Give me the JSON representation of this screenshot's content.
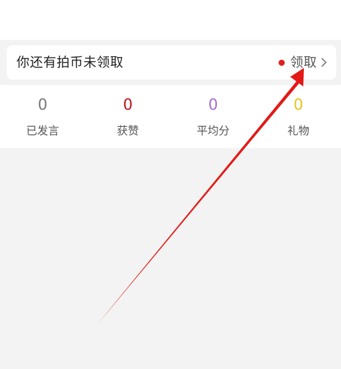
{
  "banner": {
    "message": "你还有拍币未领取",
    "claim_label": "领取"
  },
  "stats": [
    {
      "value": "0",
      "label": "已发言",
      "color": "#777777"
    },
    {
      "value": "0",
      "label": "获赞",
      "color": "#c0121b"
    },
    {
      "value": "0",
      "label": "平均分",
      "color": "#a66cc9"
    },
    {
      "value": "0",
      "label": "礼物",
      "color": "#e6c41c"
    }
  ],
  "colors": {
    "dot": "#e0201c",
    "annotation_arrow": "#e21a16",
    "background": "#f3f3f3"
  },
  "icons": {
    "claim_chevron": "chevron-right-icon",
    "unread_indicator": "red-dot-icon"
  }
}
